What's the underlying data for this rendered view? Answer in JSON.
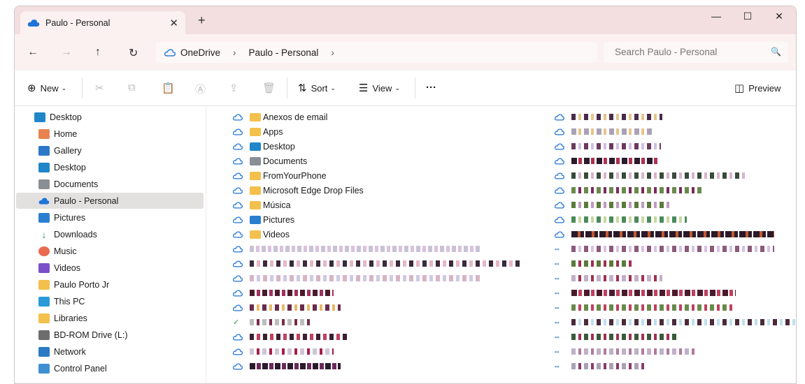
{
  "tab": {
    "title": "Paulo - Personal"
  },
  "address": {
    "crumbs": [
      "OneDrive",
      "Paulo - Personal"
    ]
  },
  "search": {
    "placeholder": "Search Paulo - Personal"
  },
  "toolbar": {
    "new_label": "New",
    "sort_label": "Sort",
    "view_label": "View",
    "more_label": "···",
    "preview_label": "Preview"
  },
  "sidebar": {
    "items": [
      {
        "label": "Desktop",
        "icon": "desktop-icon"
      },
      {
        "label": "Home",
        "icon": "home-icon"
      },
      {
        "label": "Gallery",
        "icon": "gallery-icon"
      },
      {
        "label": "Desktop",
        "icon": "desktop-icon"
      },
      {
        "label": "Documents",
        "icon": "documents-icon"
      },
      {
        "label": "Paulo - Personal",
        "icon": "onedrive-icon"
      },
      {
        "label": "Pictures",
        "icon": "pictures-icon"
      },
      {
        "label": "Downloads",
        "icon": "downloads-icon"
      },
      {
        "label": "Music",
        "icon": "music-icon"
      },
      {
        "label": "Videos",
        "icon": "videos-icon"
      },
      {
        "label": "Paulo Porto Jr",
        "icon": "folder-icon"
      },
      {
        "label": "This PC",
        "icon": "this-pc-icon"
      },
      {
        "label": "Libraries",
        "icon": "libraries-icon"
      },
      {
        "label": "BD-ROM Drive (L:)",
        "icon": "drive-icon"
      },
      {
        "label": "Network",
        "icon": "network-icon"
      },
      {
        "label": "Control Panel",
        "icon": "control-panel-icon"
      }
    ]
  },
  "files": {
    "items": [
      "Anexos de email",
      "Apps",
      "Desktop",
      "Documents",
      "FromYourPhone",
      "Microsoft Edge Drop Files",
      "Música",
      "Pictures",
      "Videos"
    ]
  },
  "colors": {
    "accent": "#0f6cbd",
    "titlebar": "#f3dfe0",
    "folder": "#f2c04b",
    "selected": "#e3e0e0"
  }
}
